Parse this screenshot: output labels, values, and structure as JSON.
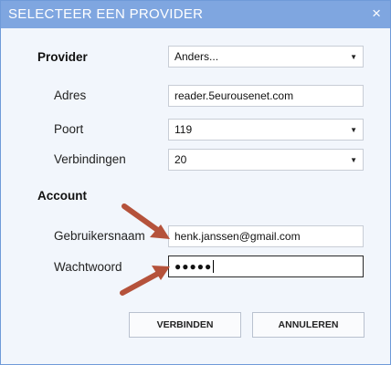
{
  "dialog": {
    "title": "SELECTEER EEN PROVIDER",
    "close_icon": "×"
  },
  "provider_section": {
    "heading": "Provider",
    "provider_value": "Anders..."
  },
  "server": {
    "address_label": "Adres",
    "address_value": "reader.5eurousenet.com",
    "port_label": "Poort",
    "port_value": "119",
    "connections_label": "Verbindingen",
    "connections_value": "20"
  },
  "account": {
    "heading": "Account",
    "username_label": "Gebruikersnaam",
    "username_value": "henk.janssen@gmail.com",
    "password_label": "Wachtwoord",
    "password_mask": "●●●●●"
  },
  "buttons": {
    "connect_label": "VERBINDEN",
    "cancel_label": "ANNULEREN"
  },
  "colors": {
    "titlebar": "#7fa6e0",
    "arrow": "#b5523b"
  }
}
